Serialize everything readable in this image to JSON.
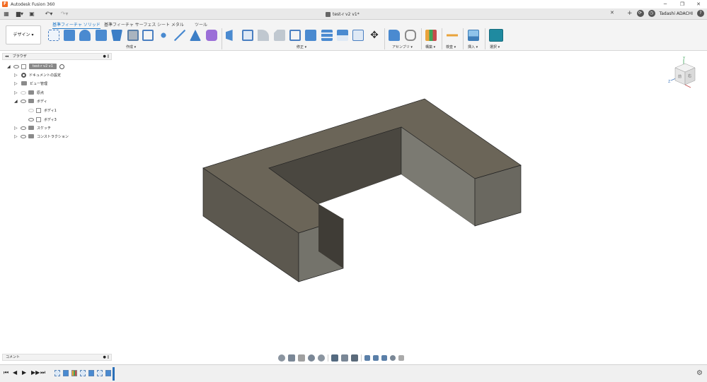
{
  "window": {
    "title": "Autodesk Fusion 360",
    "minimize": "─",
    "maximize": "❐",
    "close": "✕"
  },
  "tabbar": {
    "document_title": "test-r v2 v1*",
    "close_tab": "✕",
    "add_tab": "+",
    "user_name": "Tadashi ADACHI",
    "help": "?"
  },
  "toolbar": {
    "workspace": "デザイン ▾",
    "tabs": [
      "基準フィーチャ ソリッド",
      "基準フィーチャ サーフェス",
      "シート メタル",
      "ツール"
    ],
    "groups": [
      "作成 ▾",
      "修正 ▾",
      "アセンブリ ▾",
      "構築 ▾",
      "検査 ▾",
      "挿入 ▾",
      "選択 ▾"
    ]
  },
  "browser": {
    "header": "ブラウザ",
    "collapse": "◂◂",
    "options": "● ∥",
    "root": "test-r v2 v1",
    "items": {
      "doc_settings": "ドキュメントの設定",
      "views": "ビュー管理",
      "origin": "原点",
      "bodies": "ボディ",
      "body1": "ボディ1",
      "body3": "ボディ3",
      "sketches": "スケッチ",
      "construction": "コンストラクション"
    }
  },
  "comments": {
    "label": "コメント",
    "options": "● ∥"
  },
  "viewcube": {
    "face_front": "前",
    "face_right": "右",
    "axis_y": "Y",
    "axis_z": "Z",
    "axis_x": "X"
  },
  "timeline": {
    "first": "⏮",
    "prev": "◀",
    "play": "▶",
    "next": "▶▶",
    "last": "⏭",
    "settings": "⚙"
  },
  "colors": {
    "accent": "#1e78c8",
    "model_top": "#6b6558",
    "model_side_left": "#5c584f",
    "model_side_right": "#7a7870"
  }
}
